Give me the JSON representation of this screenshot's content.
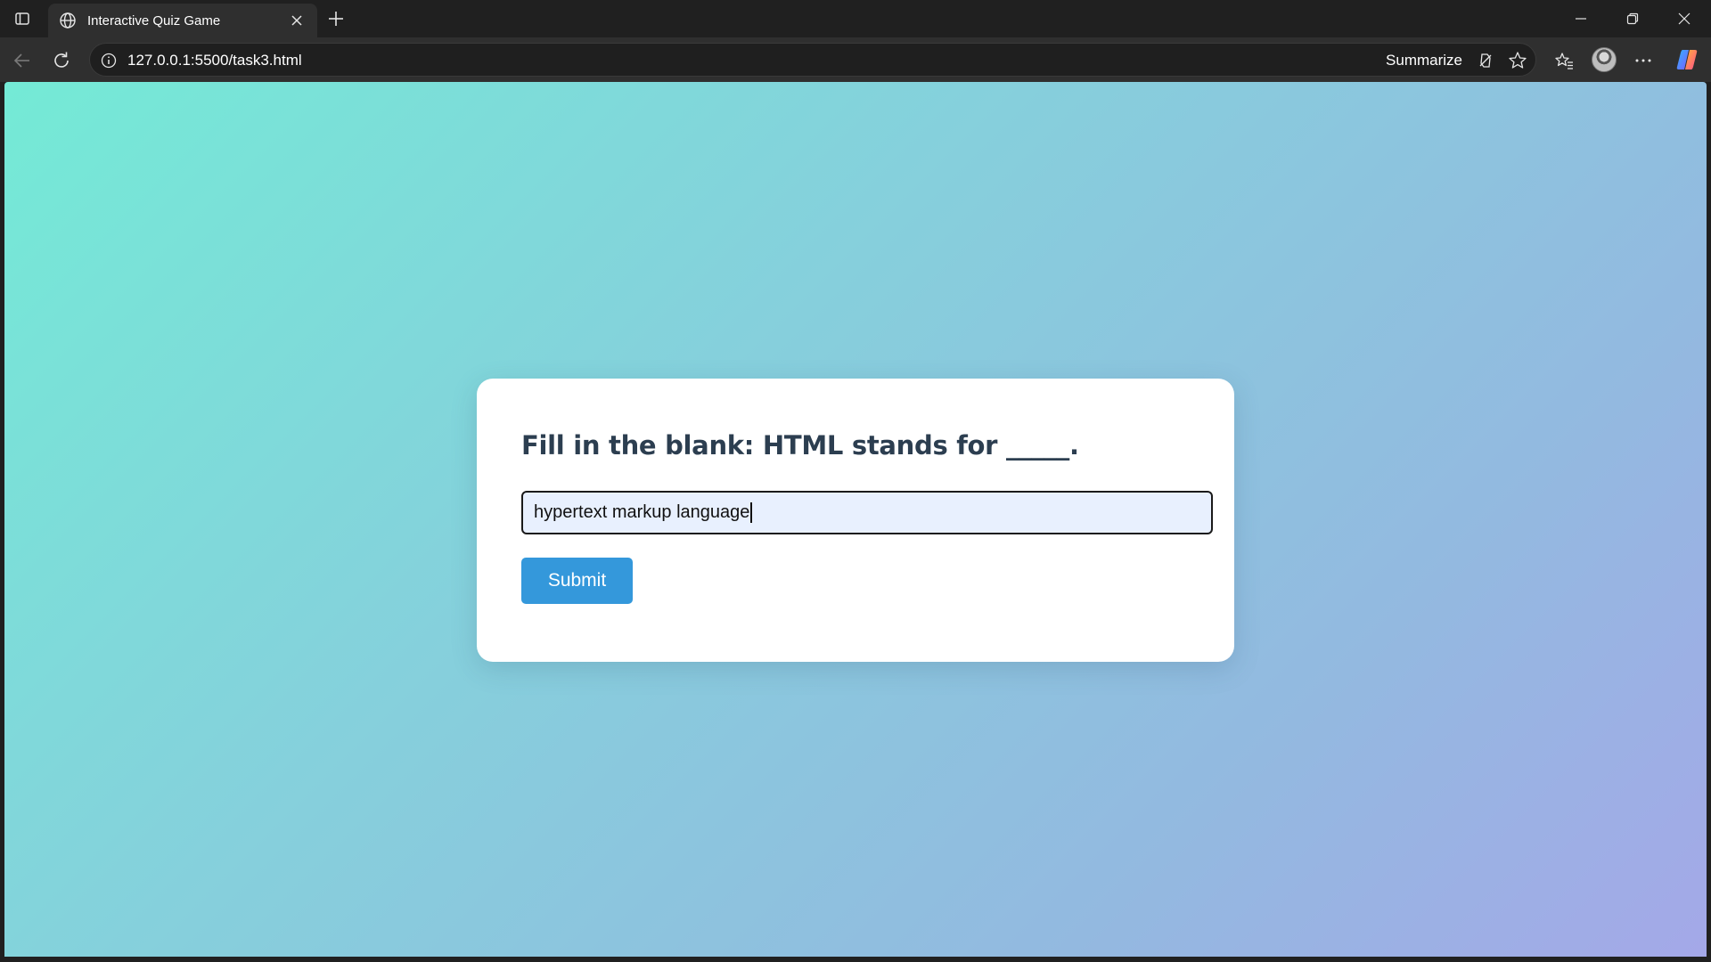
{
  "browser": {
    "tab_title": "Interactive Quiz Game",
    "url": "127.0.0.1:5500/task3.html",
    "summarize_label": "Summarize",
    "theme_color": "#202020",
    "toolbar_color": "#2f2f2f"
  },
  "icons": {
    "tab_actions": "tab-actions-icon",
    "tab": "globe-icon",
    "close": "close-icon",
    "new_tab": "plus-icon",
    "back": "back-arrow-icon",
    "refresh": "refresh-icon",
    "info": "info-icon",
    "summarize": "copilot-summarize-icon",
    "favorite": "star-icon",
    "favorites": "favorites-icon",
    "more": "more-icon",
    "profile": "avatar",
    "copilot": "copilot-icon"
  },
  "quiz": {
    "question": "Fill in the blank: HTML stands for _____.",
    "answer_value": "hypertext markup language",
    "submit_label": "Submit"
  },
  "colors": {
    "background_gradient_start": "#74ead6",
    "background_gradient_end": "#a4a8e8",
    "card": "#ffffff",
    "question_text": "#2c3e50",
    "input_bg": "#e8f0fe",
    "button": "#3498db"
  }
}
